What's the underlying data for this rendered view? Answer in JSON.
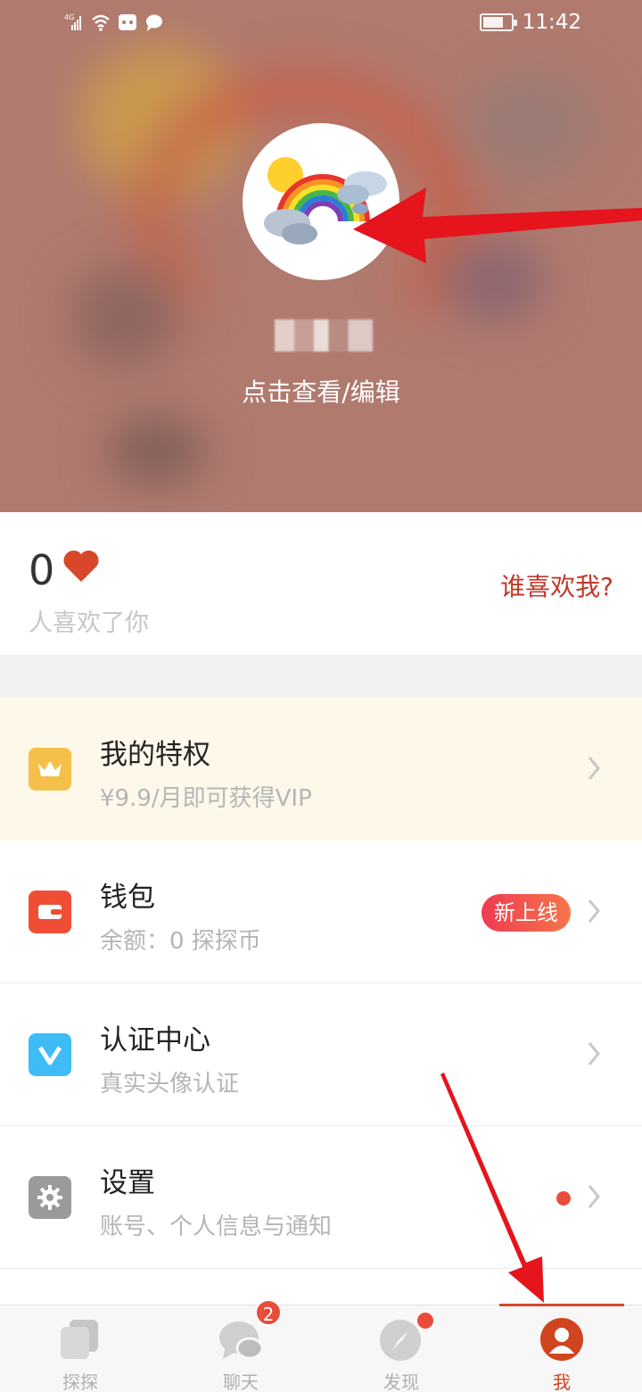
{
  "status_bar": {
    "network": "4G",
    "time": "11:42"
  },
  "profile": {
    "view_edit_label": "点击查看/编辑"
  },
  "likes": {
    "count": "0",
    "label": "人喜欢了你",
    "who_likes_link": "谁喜欢我?"
  },
  "menu": {
    "privilege": {
      "title": "我的特权",
      "subtitle": "¥9.9/月即可获得VIP"
    },
    "wallet": {
      "title": "钱包",
      "subtitle": "余额：0 探探币",
      "badge": "新上线"
    },
    "verification": {
      "title": "认证中心",
      "subtitle": "真实头像认证"
    },
    "settings": {
      "title": "设置",
      "subtitle": "账号、个人信息与通知"
    }
  },
  "tabbar": {
    "tabs": [
      {
        "label": "探探",
        "icon": "cards-icon"
      },
      {
        "label": "聊天",
        "icon": "chat-icon",
        "badge": "2"
      },
      {
        "label": "发现",
        "icon": "compass-icon"
      },
      {
        "label": "我",
        "icon": "profile-icon"
      }
    ],
    "active": "我"
  },
  "colors": {
    "accent": "#d0441e",
    "vip_icon": "#f5c04a",
    "wallet_icon": "#ef4e34",
    "verify_icon": "#3dbcf5",
    "settings_icon": "#9a9a9a",
    "header_bg": "#b07a6f"
  }
}
